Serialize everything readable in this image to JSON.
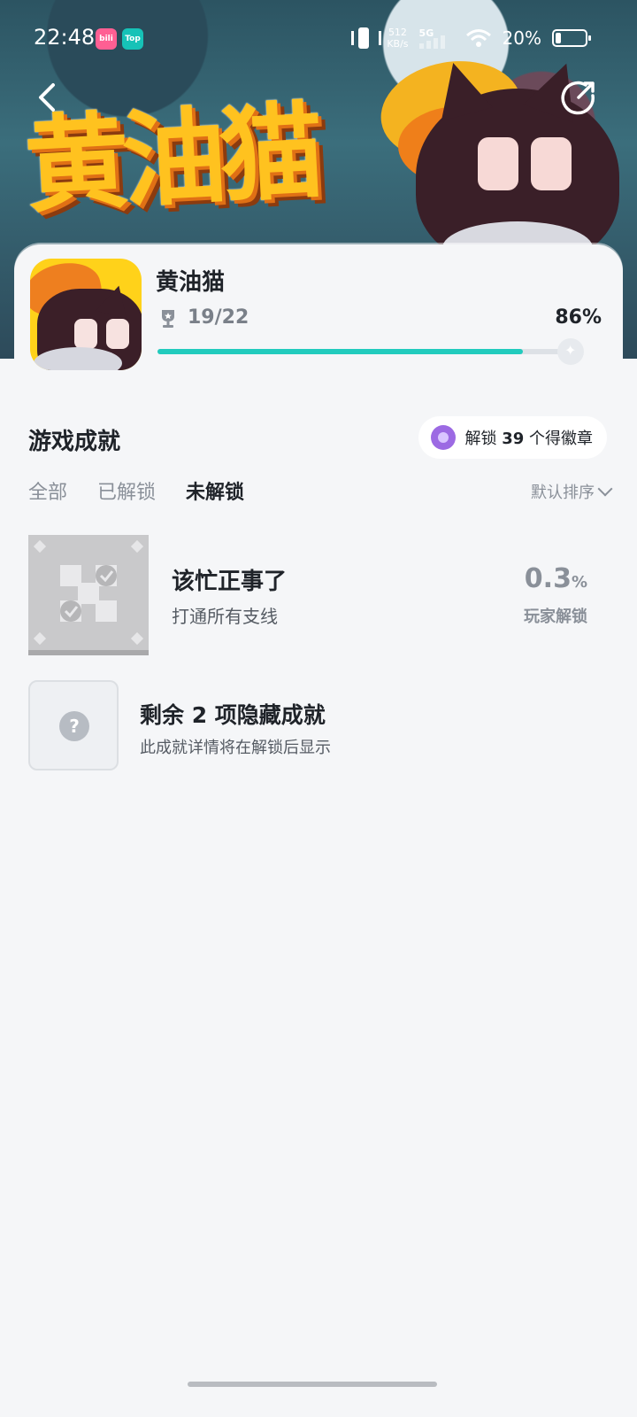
{
  "status_bar": {
    "time": "22:48",
    "apps": [
      "bilibili",
      "Top"
    ],
    "net_speed_value": "512",
    "net_speed_unit": "KB/s",
    "network": "5G",
    "battery": "20%"
  },
  "hero": {
    "title_art": "黄油猫"
  },
  "game": {
    "name": "黄油猫",
    "trophy_count": "19/22",
    "percent": "86%",
    "progress_fraction": 0.86
  },
  "achievements": {
    "section_title": "游戏成就",
    "badge_prefix": "解锁",
    "badge_number": "39",
    "badge_suffix": "个得徽章",
    "tabs": [
      {
        "label": "全部",
        "active": false
      },
      {
        "label": "已解锁",
        "active": false
      },
      {
        "label": "未解锁",
        "active": true
      }
    ],
    "sort_label": "默认排序",
    "items": [
      {
        "title": "该忙正事了",
        "description": "打通所有支线",
        "rate_value": "0.3",
        "rate_unit": "%",
        "rate_label": "玩家解锁"
      }
    ],
    "hidden": {
      "title": "剩余 2 项隐藏成就",
      "description": "此成就详情将在解锁后显示"
    }
  },
  "colors": {
    "accent": "#22cbbd",
    "background": "#f5f6f8",
    "badge": "#9c6ae3"
  }
}
